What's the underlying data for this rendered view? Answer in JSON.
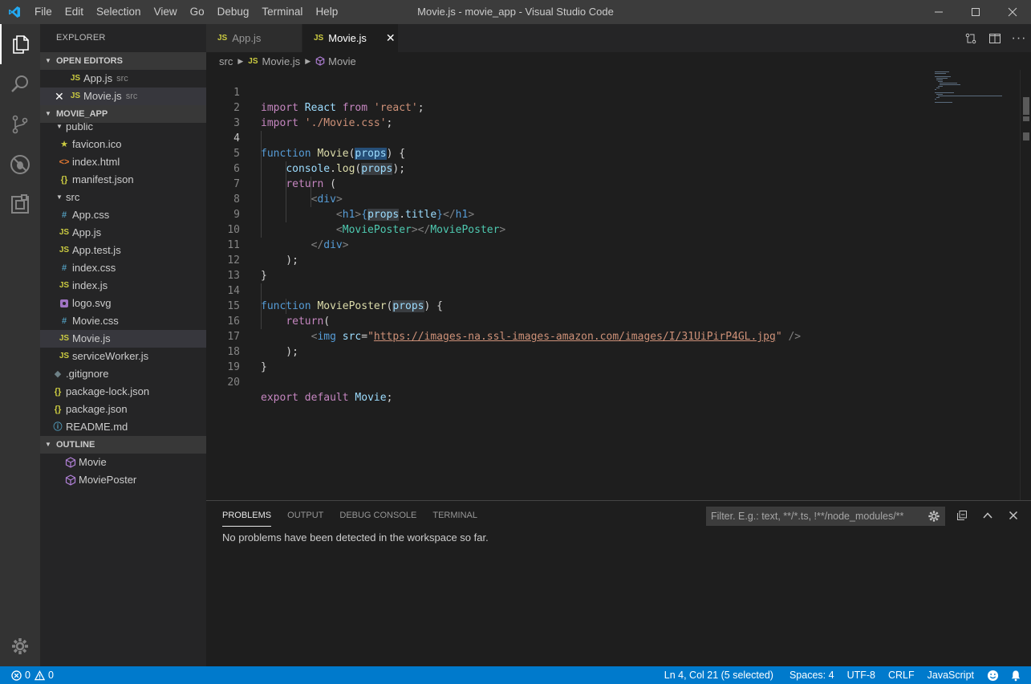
{
  "window": {
    "title": "Movie.js - movie_app - Visual Studio Code",
    "menu": [
      "File",
      "Edit",
      "Selection",
      "View",
      "Go",
      "Debug",
      "Terminal",
      "Help"
    ]
  },
  "sidebar": {
    "title": "EXPLORER",
    "open_editors": {
      "header": "OPEN EDITORS",
      "items": [
        {
          "icon": "JS",
          "name": "App.js",
          "desc": "src"
        },
        {
          "icon": "JS",
          "name": "Movie.js",
          "desc": "src"
        }
      ]
    },
    "project": {
      "header": "MOVIE_APP",
      "items": [
        {
          "icon": "",
          "name": "public"
        },
        {
          "icon": "★",
          "name": "favicon.ico"
        },
        {
          "icon": "<>",
          "name": "index.html"
        },
        {
          "icon": "{}",
          "name": "manifest.json"
        },
        {
          "icon": "",
          "name": "src"
        },
        {
          "icon": "#",
          "name": "App.css"
        },
        {
          "icon": "JS",
          "name": "App.js"
        },
        {
          "icon": "JS",
          "name": "App.test.js"
        },
        {
          "icon": "#",
          "name": "index.css"
        },
        {
          "icon": "JS",
          "name": "index.js"
        },
        {
          "icon": "",
          "name": "logo.svg"
        },
        {
          "icon": "#",
          "name": "Movie.css"
        },
        {
          "icon": "JS",
          "name": "Movie.js"
        },
        {
          "icon": "JS",
          "name": "serviceWorker.js"
        },
        {
          "icon": "◆",
          "name": ".gitignore"
        },
        {
          "icon": "{}",
          "name": "package-lock.json"
        },
        {
          "icon": "{}",
          "name": "package.json"
        },
        {
          "icon": "ⓘ",
          "name": "README.md"
        }
      ]
    },
    "outline": {
      "header": "OUTLINE",
      "items": [
        "Movie",
        "MoviePoster"
      ]
    }
  },
  "tabs": [
    {
      "icon": "JS",
      "label": "App.js"
    },
    {
      "icon": "JS",
      "label": "Movie.js",
      "close": "✕"
    }
  ],
  "breadcrumbs": {
    "folder": "src",
    "file": "Movie.js",
    "symbol": "Movie",
    "file_icon": "JS"
  },
  "editor": {
    "line_numbers": [
      "1",
      "2",
      "3",
      "4",
      "5",
      "6",
      "7",
      "8",
      "9",
      "10",
      "11",
      "12",
      "13",
      "14",
      "15",
      "16",
      "17",
      "18",
      "19",
      "20"
    ],
    "code": {
      "l1_kw": "import",
      "l1_id": "React",
      "l1_from": "from",
      "l1_str": "'react'",
      "l2_kw": "import",
      "l2_str": "'./Movie.css'",
      "l4_kw": "function",
      "l4_fn": "Movie",
      "l4_param": "props",
      "l5_obj": "console",
      "l5_fn": "log",
      "l5_arg": "props",
      "l6_kw": "return",
      "l7_tag": "div",
      "l8_tag": "h1",
      "l8_obj": "props",
      "l8_prop": "title",
      "l9_comp": "MoviePoster",
      "l10_tag": "div",
      "l14_kw": "function",
      "l14_fn": "MoviePoster",
      "l14_param": "props",
      "l15_kw": "return",
      "l16_tag": "img",
      "l16_attr": "src",
      "l16_url": "https://images-na.ssl-images-amazon.com/images/I/31UiPirP4GL.jpg",
      "l20_kw1": "export",
      "l20_kw2": "default",
      "l20_id": "Movie"
    }
  },
  "panel": {
    "tabs": [
      "PROBLEMS",
      "OUTPUT",
      "DEBUG CONSOLE",
      "TERMINAL"
    ],
    "filter_placeholder": "Filter. E.g.: text, **/*.ts, !**/node_modules/**",
    "message": "No problems have been detected in the workspace so far."
  },
  "statusbar": {
    "errors": "0",
    "warnings": "0",
    "position": "Ln 4, Col 21 (5 selected)",
    "spaces": "Spaces: 4",
    "encoding": "UTF-8",
    "eol": "CRLF",
    "language": "JavaScript"
  },
  "colors": {
    "accent": "#007acc",
    "js_icon": "#cbcb41",
    "selection": "#264f78"
  }
}
